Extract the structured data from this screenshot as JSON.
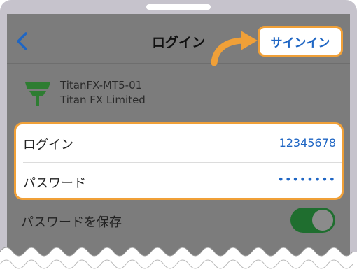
{
  "navbar": {
    "back_icon": "chevron-left-icon",
    "title": "ログイン",
    "signin_label": "サインイン"
  },
  "account": {
    "logo_icon": "titan-fx-logo",
    "server": "TitanFX-MT5-01",
    "company": "Titan FX Limited"
  },
  "form": {
    "login_label": "ログイン",
    "login_value": "12345678",
    "password_label": "パスワード",
    "password_value": "••••••••"
  },
  "save_password": {
    "label": "パスワードを保存",
    "enabled": true
  },
  "colors": {
    "accent": "#1f66c4",
    "highlight": "#f0a038",
    "toggle_on": "#1f6e2f",
    "logo_green": "#2e7d32"
  }
}
